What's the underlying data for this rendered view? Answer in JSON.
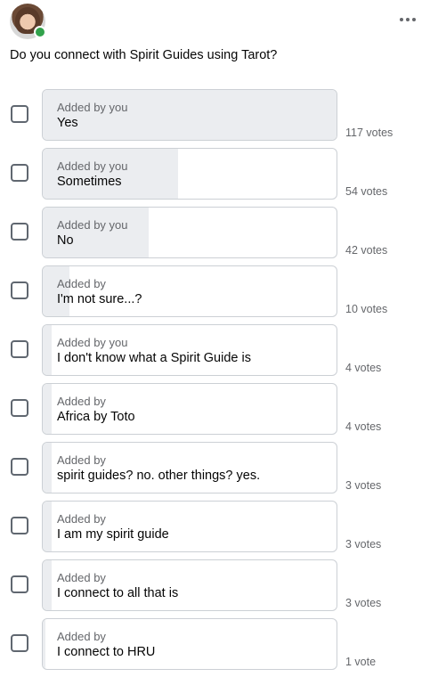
{
  "post": {
    "question": "Do you connect with Spirit Guides using Tarot?"
  },
  "icons": {
    "avatar": "user-avatar",
    "more": "more-horizontal-icon",
    "online_color": "#31a24c"
  },
  "colors": {
    "bar_fill": "#ebedf0",
    "border": "#ccd0d5",
    "secondary_text": "#65676b"
  },
  "options": [
    {
      "added_by": "Added by you",
      "label": "Yes",
      "votes": "117 votes",
      "share": 1.0,
      "checked": false
    },
    {
      "added_by": "Added by you",
      "label": "Sometimes",
      "votes": "54 votes",
      "share": 0.46,
      "checked": false
    },
    {
      "added_by": "Added by you",
      "label": "No",
      "votes": "42 votes",
      "share": 0.36,
      "checked": false
    },
    {
      "added_by": "Added by",
      "label": "I'm not sure...?",
      "votes": "10 votes",
      "share": 0.09,
      "checked": false
    },
    {
      "added_by": "Added by you",
      "label": "I don't know what a Spirit Guide is",
      "votes": "4 votes",
      "share": 0.03,
      "checked": false
    },
    {
      "added_by": "Added by",
      "label": "Africa by Toto",
      "votes": "4 votes",
      "share": 0.03,
      "checked": false
    },
    {
      "added_by": "Added by",
      "label": "spirit guides? no. other things? yes.",
      "votes": "3 votes",
      "share": 0.03,
      "checked": false
    },
    {
      "added_by": "Added by",
      "label": "I am my spirit guide",
      "votes": "3 votes",
      "share": 0.03,
      "checked": false
    },
    {
      "added_by": "Added by",
      "label": "I connect to all that is",
      "votes": "3 votes",
      "share": 0.03,
      "checked": false
    },
    {
      "added_by": "Added by",
      "label": "I connect to HRU",
      "votes": "1 vote",
      "share": 0.01,
      "checked": false
    }
  ]
}
